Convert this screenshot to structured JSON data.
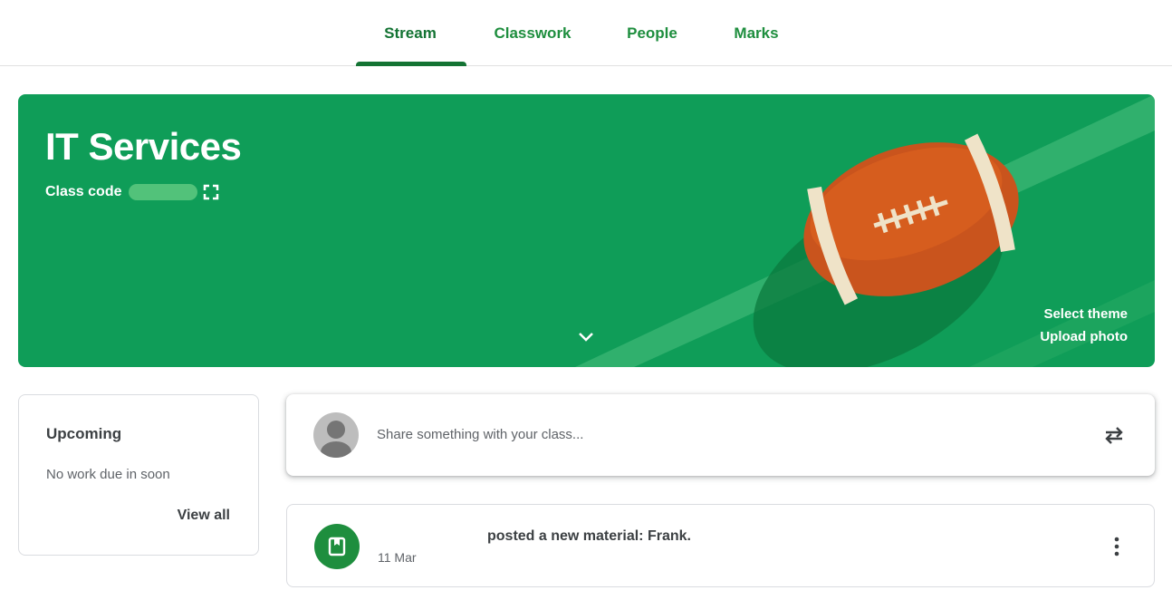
{
  "nav": {
    "tabs": [
      {
        "label": "Stream",
        "active": true
      },
      {
        "label": "Classwork",
        "active": false
      },
      {
        "label": "People",
        "active": false
      },
      {
        "label": "Marks",
        "active": false
      }
    ]
  },
  "banner": {
    "title": "IT Services",
    "class_code_label": "Class code",
    "class_code_value": "",
    "select_theme": "Select theme",
    "upload_photo": "Upload photo",
    "theme_color": "#0f9d58"
  },
  "upcoming": {
    "title": "Upcoming",
    "empty_text": "No work due in soon",
    "view_all": "View all"
  },
  "share": {
    "placeholder": "Share something with your class..."
  },
  "posts": [
    {
      "text": "posted a new material: Frank.",
      "date": "11 Mar",
      "icon": "material-book-icon"
    }
  ],
  "colors": {
    "accent": "#137333",
    "tab_text": "#1e8e3e",
    "banner": "#0f9d58"
  }
}
